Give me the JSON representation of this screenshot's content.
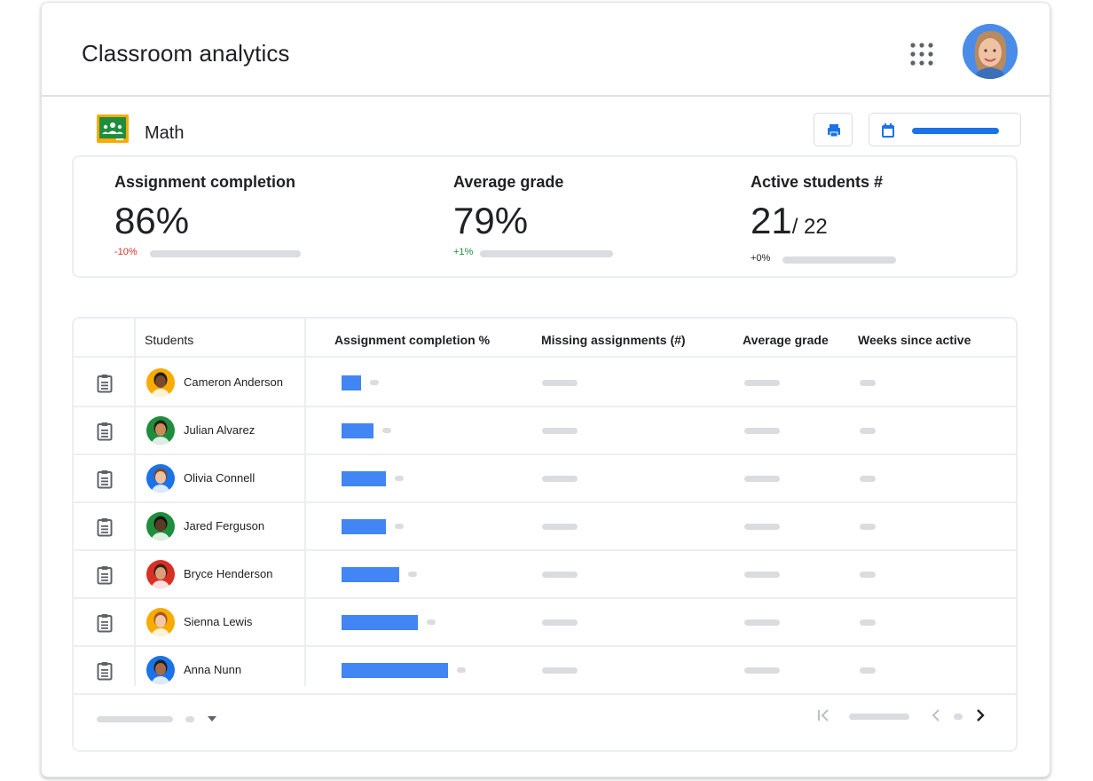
{
  "header": {
    "title": "Classroom analytics",
    "apps_icon": "apps-grid-icon",
    "avatar_icon": "user-avatar"
  },
  "class": {
    "name": "Math",
    "logo_icon": "google-classroom-icon",
    "print_icon": "print-icon",
    "date_icon": "calendar-icon"
  },
  "stats": [
    {
      "label": "Assignment completion",
      "value": "86%",
      "delta": "-10%",
      "trend": "negative"
    },
    {
      "label": "Average grade",
      "value": "79%",
      "delta": "+1%",
      "trend": "positive"
    },
    {
      "label": "Active students  #",
      "value": "21",
      "total": "/ 22",
      "delta": "+0%",
      "trend": "neutral"
    }
  ],
  "table": {
    "columns": {
      "students": "Students",
      "completion": "Assignment completion %",
      "missing": "Missing assignments (#)",
      "grade": "Average grade",
      "weeks": "Weeks since active"
    },
    "rows": [
      {
        "name": "Cameron Anderson",
        "completion_fraction": 0.18
      },
      {
        "name": "Julian Alvarez",
        "completion_fraction": 0.3
      },
      {
        "name": "Olivia Connell",
        "completion_fraction": 0.42
      },
      {
        "name": "Jared  Ferguson",
        "completion_fraction": 0.42
      },
      {
        "name": "Bryce Henderson",
        "completion_fraction": 0.54
      },
      {
        "name": "Sienna Lewis",
        "completion_fraction": 0.72
      },
      {
        "name": "Anna Nunn",
        "completion_fraction": 1.0
      }
    ]
  },
  "pagination": {
    "first_icon": "first-page-icon",
    "prev_icon": "chevron-left-icon",
    "next_icon": "chevron-right-icon",
    "dropdown_icon": "dropdown-arrow-icon"
  },
  "colors": {
    "accent": "#1a73e8",
    "bar": "#4285f4",
    "negative": "#d93025",
    "positive": "#1e8e3e",
    "placeholder": "#dadce0"
  }
}
